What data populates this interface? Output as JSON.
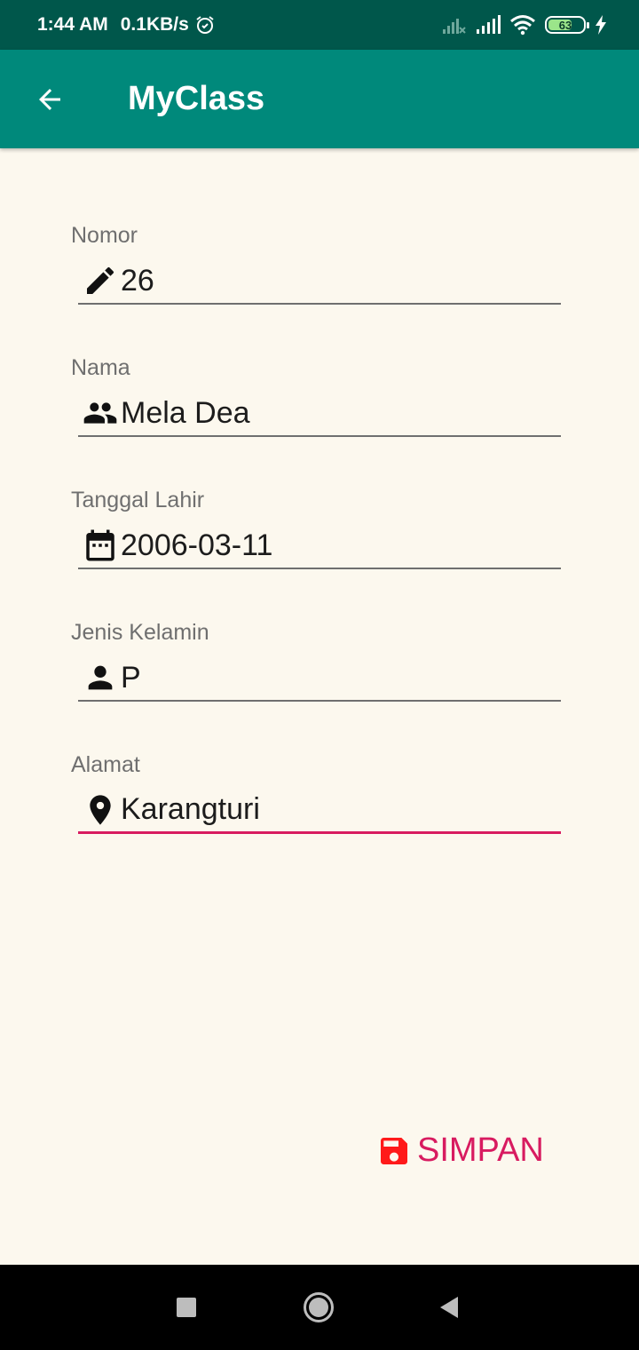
{
  "status_bar": {
    "time": "1:44 AM",
    "speed": "0.1KB/s",
    "battery_level": "63"
  },
  "app_bar": {
    "title": "MyClass"
  },
  "form": {
    "fields": [
      {
        "label": "Nomor",
        "value": "26",
        "icon": "pencil-icon"
      },
      {
        "label": "Nama",
        "value": "Mela Dea",
        "icon": "people-icon"
      },
      {
        "label": "Tanggal Lahir",
        "value": "2006-03-11",
        "icon": "calendar-icon"
      },
      {
        "label": "Jenis Kelamin",
        "value": "P",
        "icon": "person-icon"
      },
      {
        "label": "Alamat",
        "value": "Karangturi",
        "icon": "location-pin-icon"
      }
    ]
  },
  "save_button": {
    "label": "SIMPAN",
    "icon": "floppy-disk-icon"
  },
  "colors": {
    "status_bar": "#00574b",
    "app_bar": "#00897b",
    "background": "#fcf8ee",
    "accent": "#d81b60",
    "save_icon": "#ff1a1a"
  }
}
